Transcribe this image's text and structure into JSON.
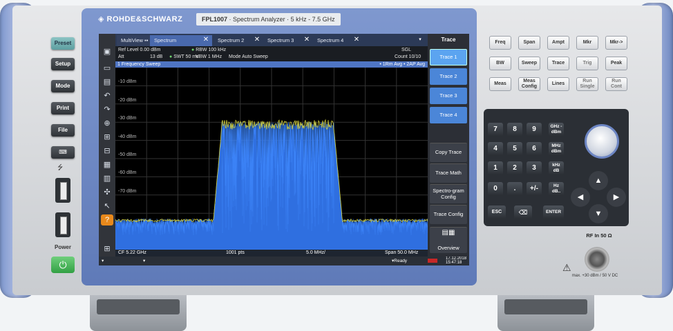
{
  "brand": {
    "logo": "ROHDE&SCHWARZ",
    "model": "FPL1007",
    "product": "Spectrum Analyzer",
    "range": "5 kHz - 7.5 GHz"
  },
  "left_keys": {
    "preset": "Preset",
    "setup": "Setup",
    "mode": "Mode",
    "print": "Print",
    "file": "File",
    "power": "Power"
  },
  "tabs": [
    {
      "label": "MultiView"
    },
    {
      "label": "Spectrum"
    },
    {
      "label": "Spectrum 2"
    },
    {
      "label": "Spectrum 3"
    },
    {
      "label": "Spectrum 4"
    }
  ],
  "info": {
    "ref_level": "Ref Level  0.00 dBm",
    "att": "Att",
    "att_val": "13 dB",
    "swt": "SWT  50 ms",
    "rbw": "RBW  100 kHz",
    "vbw": "VBW  1 MHz",
    "mode": "Mode  Auto Sweep",
    "sgl": "SGL",
    "count": "Count 10/10"
  },
  "sweep": {
    "title": "1 Frequency Sweep",
    "legend": "• 1Rm Avg  • 2AP Avg"
  },
  "plot": {
    "y_labels": [
      "-10 dBm",
      "-20 dBm",
      "-30 dBm",
      "-40 dBm",
      "-50 dBm",
      "-60 dBm",
      "-70 dBm"
    ]
  },
  "status": {
    "cf": "CF 5.22 GHz",
    "pts": "1001 pts",
    "div": "5.0 MHz/",
    "span": "Span 50.0 MHz"
  },
  "bottom": {
    "ready": "Ready",
    "date": "17.12.2018",
    "time": "15:47:18"
  },
  "softkeys": {
    "title": "Trace",
    "items": [
      "Trace 1",
      "Trace 2",
      "Trace 3",
      "Trace 4",
      "Copy Trace",
      "Trace Math",
      "Spectro-gram Config",
      "Trace Config",
      "Overview"
    ]
  },
  "right_keys": {
    "row1": [
      "Freq",
      "Span",
      "Ampt",
      "Mkr",
      "Mkr->"
    ],
    "row2": [
      "BW",
      "Sweep",
      "Trace",
      "Trig",
      "Peak"
    ],
    "row3": [
      "Meas",
      "Meas Config",
      "Lines",
      "Run Single",
      "Run Cont"
    ]
  },
  "keypad": {
    "digits": [
      "7",
      "8",
      "9",
      "4",
      "5",
      "6",
      "1",
      "2",
      "3",
      "0",
      ".",
      "+/-"
    ],
    "units": [
      "GHz -dBm",
      "MHz dBm",
      "kHz dB",
      "Hz dB.."
    ],
    "esc": "ESC",
    "enter": "ENTER"
  },
  "rf": {
    "label": "RF In 50 Ω",
    "max": "max. +30 dBm / 50 V DC"
  }
}
